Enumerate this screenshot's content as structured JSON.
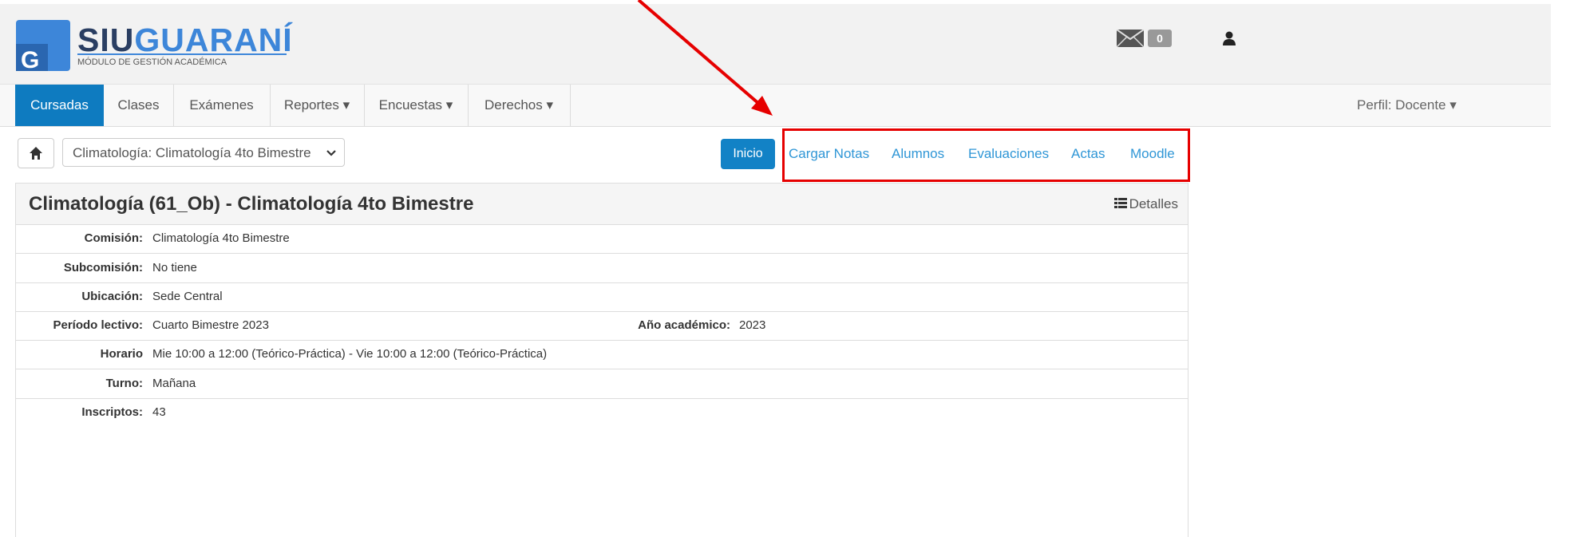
{
  "logo": {
    "title_a": "SIU",
    "title_b": "GUARANÍ",
    "subtitle": "MÓDULO DE GESTIÓN ACADÉMICA"
  },
  "header": {
    "mail_count": "0"
  },
  "nav": {
    "items": [
      "Cursadas",
      "Clases",
      "Exámenes",
      "Reportes ▾",
      "Encuestas ▾",
      "Derechos ▾"
    ],
    "profile": "Perfil: Docente ▾"
  },
  "toolbar": {
    "course_select": "Climatología: Climatología 4to Bimestre",
    "inicio": "Inicio",
    "links": [
      "Cargar Notas",
      "Alumnos",
      "Evaluaciones",
      "Actas",
      "Moodle"
    ]
  },
  "panel": {
    "title": "Climatología (61_Ob) - Climatología 4to Bimestre",
    "details": "Detalles",
    "rows": [
      {
        "label": "Comisión:",
        "value": "Climatología 4to Bimestre"
      },
      {
        "label": "Subcomisión:",
        "value": "No tiene"
      },
      {
        "label": "Ubicación:",
        "value": "Sede Central"
      },
      {
        "label": "Período lectivo:",
        "value": "Cuarto Bimestre 2023",
        "label2": "Año académico:",
        "value2": "2023"
      },
      {
        "label": "Horario",
        "value": "Mie 10:00 a 12:00 (Teórico-Práctica) - Vie 10:00 a 12:00 (Teórico-Práctica)"
      },
      {
        "label": "Turno:",
        "value": "Mañana"
      },
      {
        "label": "Inscriptos:",
        "value": "43"
      }
    ]
  },
  "colors": {
    "brand": "#0e7bc0",
    "link": "#2f96d6",
    "annotation": "#e60000"
  }
}
